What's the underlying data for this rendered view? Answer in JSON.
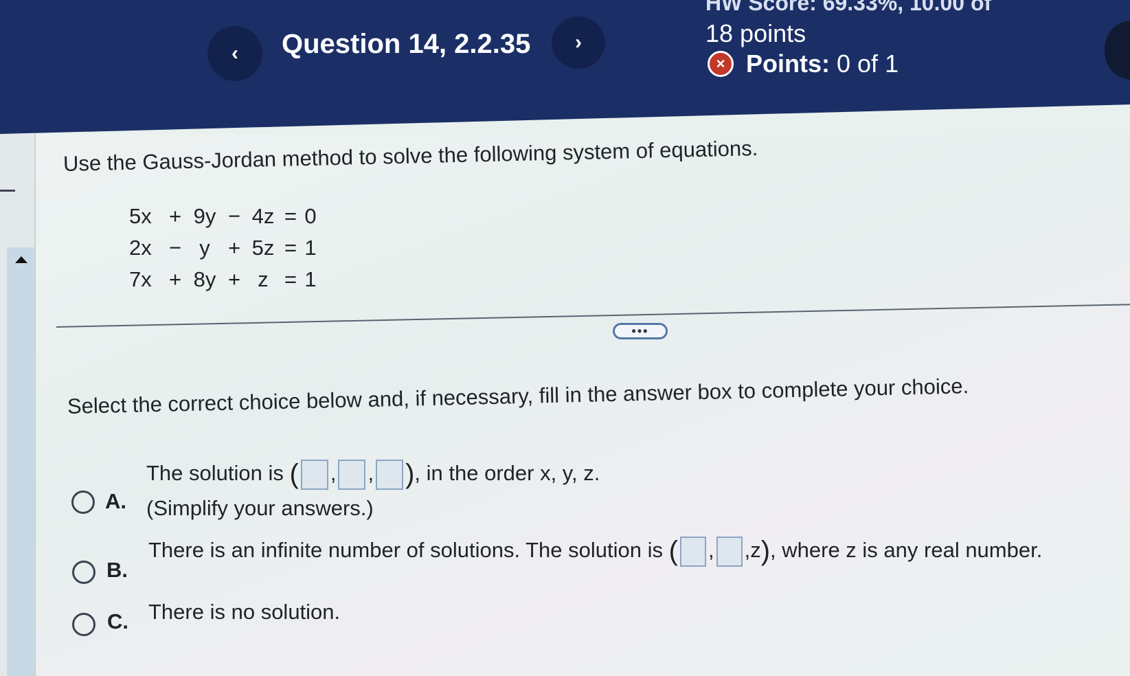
{
  "header": {
    "prev_label": "‹",
    "question_title": "Question 14, 2.2.35",
    "next_label": "›",
    "hw_score": "HW Score: 69.33%, 10.00 of",
    "points_total": "18 points",
    "points_label": "Points:",
    "points_value": "0 of 1",
    "incorrect_icon": "×"
  },
  "question": {
    "instruction": "Use the Gauss-Jordan method to solve the following system of equations.",
    "equations": [
      {
        "t1": "5x",
        "op1": "+",
        "t2": "9y",
        "op2": "−",
        "t3": "4z",
        "eq": "=",
        "rhs": "0"
      },
      {
        "t1": "2x",
        "op1": "−",
        "t2": "y",
        "op2": "+",
        "t3": "5z",
        "eq": "=",
        "rhs": "1"
      },
      {
        "t1": "7x",
        "op1": "+",
        "t2": "8y",
        "op2": "+",
        "t3": "z",
        "eq": "=",
        "rhs": "1"
      }
    ],
    "expand_label": "•••"
  },
  "answer": {
    "select_instruction": "Select the correct choice below and, if necessary, fill in the answer box to complete your choice.",
    "option_a": {
      "letter": "A.",
      "line1_prefix": "The solution is",
      "open": "(",
      "comma": ",",
      "close": ")",
      "line1_suffix": ", in the order x, y, z.",
      "line2": "(Simplify your answers.)"
    },
    "option_b": {
      "letter": "B.",
      "prefix": "There is an infinite number of solutions. The solution is",
      "open": "(",
      "comma": ",",
      "z": ",z",
      "close": ")",
      "suffix": ", where z is any real number."
    },
    "option_c": {
      "letter": "C.",
      "text": "There is no solution."
    }
  }
}
